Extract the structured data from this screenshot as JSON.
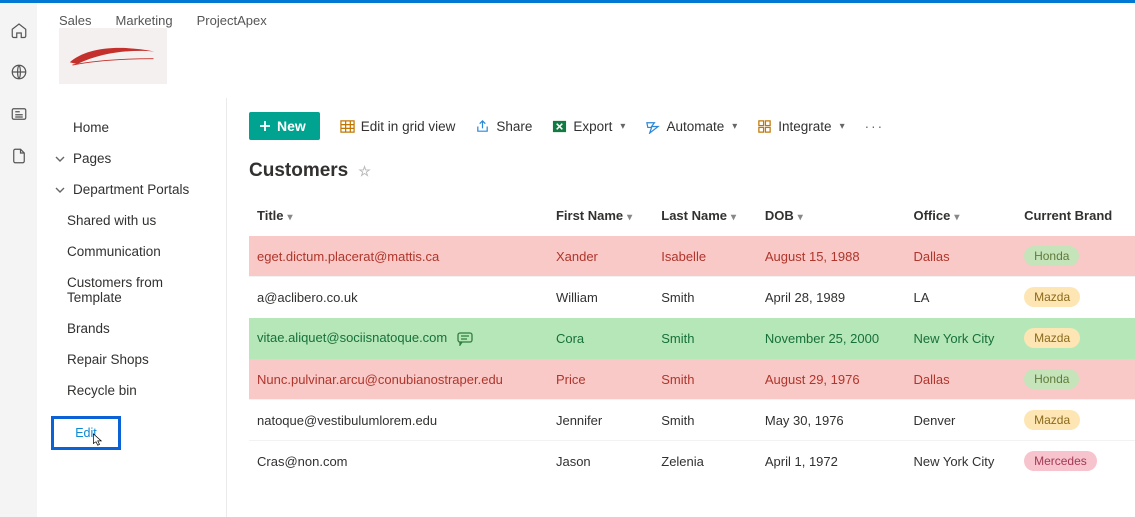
{
  "topnav": {
    "items": [
      "Sales",
      "Marketing",
      "ProjectApex"
    ]
  },
  "rail": {
    "icons": [
      "home-icon",
      "globe-icon",
      "news-icon",
      "file-icon"
    ]
  },
  "leftnav": {
    "home": "Home",
    "pages": "Pages",
    "dept": "Department Portals",
    "items": [
      "Shared with us",
      "Communication",
      "Customers from Template",
      "Brands",
      "Repair Shops",
      "Recycle bin"
    ],
    "edit": "Edit"
  },
  "commands": {
    "new": "New",
    "editgrid": "Edit in grid view",
    "share": "Share",
    "export": "Export",
    "automate": "Automate",
    "integrate": "Integrate"
  },
  "list": {
    "title": "Customers",
    "columns": [
      "Title",
      "First Name",
      "Last Name",
      "DOB",
      "Office",
      "Current Brand"
    ]
  },
  "rows": [
    {
      "style": "red",
      "title": "eget.dictum.placerat@mattis.ca",
      "first": "Xander",
      "last": "Isabelle",
      "dob": "August 15, 1988",
      "office": "Dallas",
      "brand": "Honda",
      "brandClass": "honda",
      "comment": false
    },
    {
      "style": "",
      "title": "a@aclibero.co.uk",
      "first": "William",
      "last": "Smith",
      "dob": "April 28, 1989",
      "office": "LA",
      "brand": "Mazda",
      "brandClass": "mazda",
      "comment": false
    },
    {
      "style": "green",
      "title": "vitae.aliquet@sociisnatoque.com",
      "first": "Cora",
      "last": "Smith",
      "dob": "November 25, 2000",
      "office": "New York City",
      "brand": "Mazda",
      "brandClass": "mazda",
      "comment": true
    },
    {
      "style": "red",
      "title": "Nunc.pulvinar.arcu@conubianostraper.edu",
      "first": "Price",
      "last": "Smith",
      "dob": "August 29, 1976",
      "office": "Dallas",
      "brand": "Honda",
      "brandClass": "honda",
      "comment": false
    },
    {
      "style": "",
      "title": "natoque@vestibulumlorem.edu",
      "first": "Jennifer",
      "last": "Smith",
      "dob": "May 30, 1976",
      "office": "Denver",
      "brand": "Mazda",
      "brandClass": "mazda",
      "comment": false
    },
    {
      "style": "",
      "title": "Cras@non.com",
      "first": "Jason",
      "last": "Zelenia",
      "dob": "April 1, 1972",
      "office": "New York City",
      "brand": "Mercedes",
      "brandClass": "mercedes",
      "comment": false
    }
  ]
}
